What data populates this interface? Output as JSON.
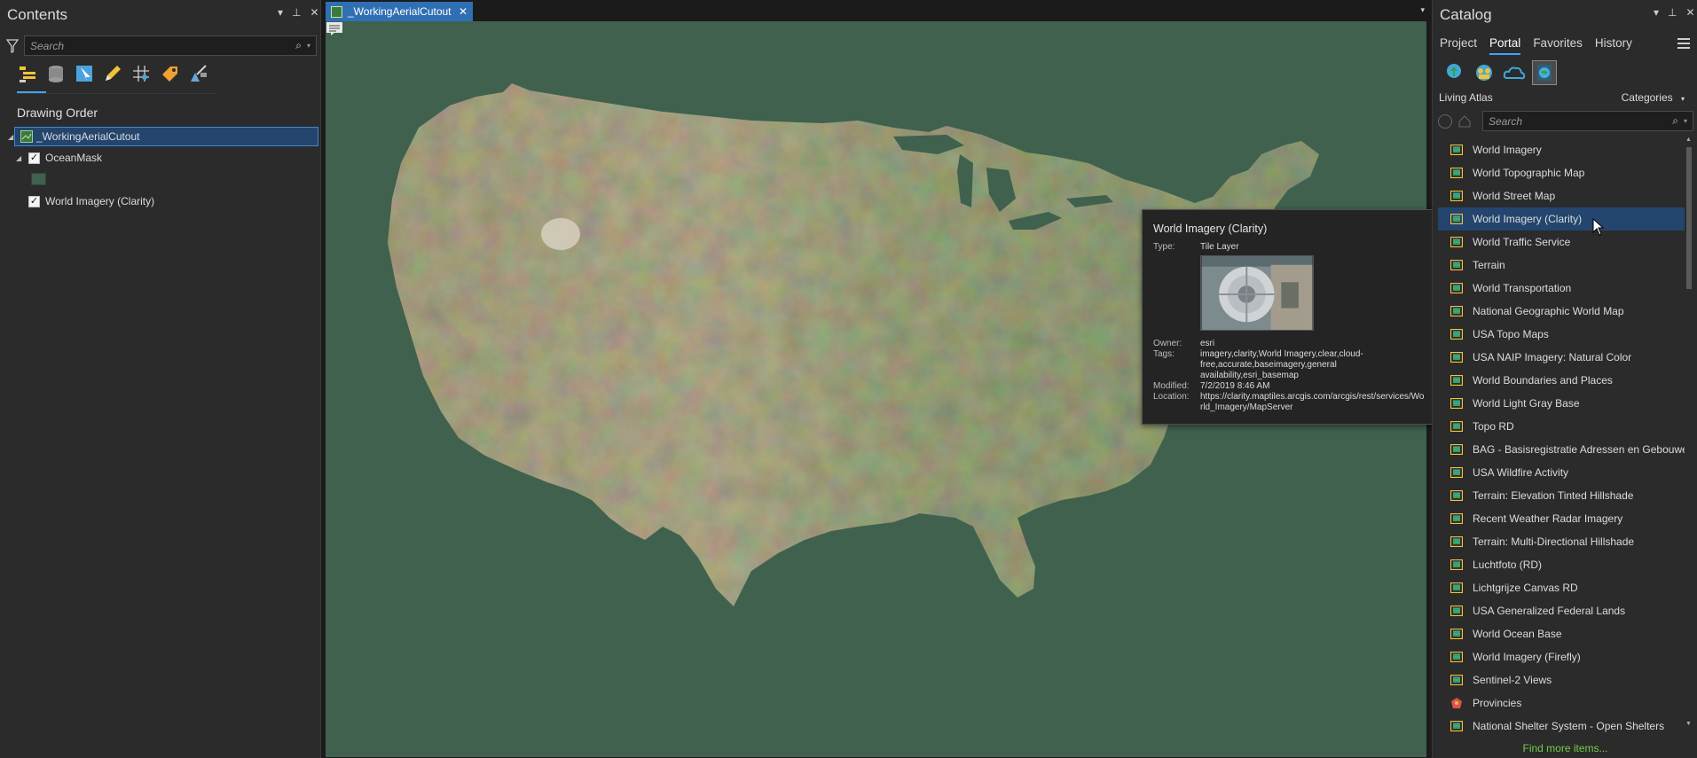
{
  "contents": {
    "title": "Contents",
    "search_placeholder": "Search",
    "section_title": "Drawing Order",
    "layers": [
      {
        "label": "_WorkingAerialCutout"
      },
      {
        "label": "OceanMask"
      },
      {
        "label": "World Imagery (Clarity)"
      }
    ]
  },
  "map": {
    "tab_label": "_WorkingAerialCutout",
    "background_color": "#3f614e"
  },
  "tooltip": {
    "title": "World Imagery (Clarity)",
    "type_key": "Type:",
    "type_val": "Tile Layer",
    "owner_key": "Owner:",
    "owner_val": "esri",
    "tags_key": "Tags:",
    "tags_val": "imagery,clarity,World Imagery,clear,cloud-free,accurate,baseimagery,general availability,esri_basemap",
    "modified_key": "Modified:",
    "modified_val": "7/2/2019 8:46 AM",
    "location_key": "Location:",
    "location_val": "https://clarity.maptiles.arcgis.com/arcgis/rest/services/World_Imagery/MapServer"
  },
  "catalog": {
    "title": "Catalog",
    "tabs": [
      "Project",
      "Portal",
      "Favorites",
      "History"
    ],
    "active_tab": "Portal",
    "living_atlas": "Living Atlas",
    "categories": "Categories",
    "search_placeholder": "Search",
    "items": [
      "World Imagery",
      "World Topographic Map",
      "World Street Map",
      "World Imagery (Clarity)",
      "World Traffic Service",
      "Terrain",
      "World Transportation",
      "National Geographic World Map",
      "USA Topo Maps",
      "USA NAIP Imagery: Natural Color",
      "World Boundaries and Places",
      "World Light Gray Base",
      "Topo RD",
      "BAG - Basisregistratie Adressen en Gebouwe",
      "USA Wildfire Activity",
      "Terrain: Elevation Tinted Hillshade",
      "Recent Weather Radar Imagery",
      "Terrain: Multi-Directional Hillshade",
      "Luchtfoto (RD)",
      "Lichtgrijze Canvas RD",
      "USA Generalized Federal Lands",
      "World Ocean Base",
      "World Imagery (Firefly)",
      "Sentinel-2 Views",
      "Provincies",
      "National Shelter System - Open Shelters"
    ],
    "selected_item": "World Imagery (Clarity)",
    "find_more": "Find more items..."
  }
}
